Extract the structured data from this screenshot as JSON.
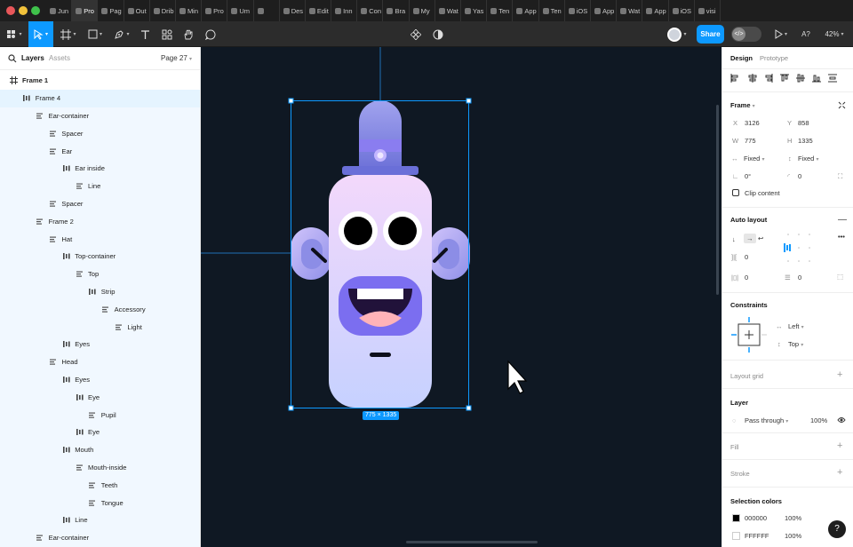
{
  "tabs": [
    "Jun",
    "Pro",
    "Pag",
    "Out",
    "Drib",
    "Min",
    "Pro",
    "Um",
    "",
    "Des",
    "Edit",
    "Inn",
    "Con",
    "Bra",
    "My",
    "Wat",
    "Yas",
    "Ten",
    "App",
    "Ten",
    "iOS",
    "App",
    "Wat",
    "App",
    "iOS",
    "visi"
  ],
  "toolbar": {
    "share_label": "Share",
    "zoom": "42%",
    "help": "A?"
  },
  "left": {
    "tab_layers": "Layers",
    "tab_assets": "Assets",
    "page": "Page 27",
    "layers": [
      {
        "label": "Frame 1",
        "depth": 0,
        "icon": "frame"
      },
      {
        "label": "Frame 4",
        "depth": 1,
        "icon": "vbars"
      },
      {
        "label": "Ear-container",
        "depth": 2,
        "icon": "lines"
      },
      {
        "label": "Spacer",
        "depth": 3,
        "icon": "lines"
      },
      {
        "label": "Ear",
        "depth": 3,
        "icon": "lines"
      },
      {
        "label": "Ear inside",
        "depth": 4,
        "icon": "vbars"
      },
      {
        "label": "Line",
        "depth": 5,
        "icon": "lines"
      },
      {
        "label": "Spacer",
        "depth": 3,
        "icon": "lines"
      },
      {
        "label": "Frame 2",
        "depth": 2,
        "icon": "lines"
      },
      {
        "label": "Hat",
        "depth": 3,
        "icon": "lines"
      },
      {
        "label": "Top-container",
        "depth": 4,
        "icon": "vbars"
      },
      {
        "label": "Top",
        "depth": 5,
        "icon": "lines"
      },
      {
        "label": "Strip",
        "depth": 6,
        "icon": "vbars"
      },
      {
        "label": "Accessory",
        "depth": 7,
        "icon": "lines"
      },
      {
        "label": "Light",
        "depth": 8,
        "icon": "lines"
      },
      {
        "label": "Eyes",
        "depth": 4,
        "icon": "vbars"
      },
      {
        "label": "Head",
        "depth": 3,
        "icon": "lines"
      },
      {
        "label": "Eyes",
        "depth": 4,
        "icon": "vbars"
      },
      {
        "label": "Eye",
        "depth": 5,
        "icon": "vbars"
      },
      {
        "label": "Pupil",
        "depth": 6,
        "icon": "lines"
      },
      {
        "label": "Eye",
        "depth": 5,
        "icon": "vbars"
      },
      {
        "label": "Mouth",
        "depth": 4,
        "icon": "vbars"
      },
      {
        "label": "Mouth-inside",
        "depth": 5,
        "icon": "lines"
      },
      {
        "label": "Teeth",
        "depth": 6,
        "icon": "lines"
      },
      {
        "label": "Tongue",
        "depth": 6,
        "icon": "lines"
      },
      {
        "label": "Line",
        "depth": 4,
        "icon": "vbars"
      },
      {
        "label": "Ear-container",
        "depth": 2,
        "icon": "lines"
      }
    ]
  },
  "canvas": {
    "size_label": "775 × 1335"
  },
  "right": {
    "tab_design": "Design",
    "tab_prototype": "Prototype",
    "frame_title": "Frame",
    "x_label": "X",
    "x": "3126",
    "y_label": "Y",
    "y": "858",
    "w_label": "W",
    "w": "775",
    "h_label": "H",
    "h": "1335",
    "hsizing": "Fixed",
    "vsizing": "Fixed",
    "rotation": "0°",
    "radius": "0",
    "clip": "Clip content",
    "autolayout_title": "Auto layout",
    "spacing": "0",
    "pad_h": "0",
    "pad_v": "0",
    "constraints_title": "Constraints",
    "c_h": "Left",
    "c_v": "Top",
    "layout_grid": "Layout grid",
    "layer_title": "Layer",
    "blend": "Pass through",
    "opacity": "100%",
    "fill": "Fill",
    "stroke": "Stroke",
    "selection_colors": "Selection colors",
    "colors": [
      {
        "hex": "000000",
        "opacity": "100%",
        "swatch": "#000000"
      },
      {
        "hex": "FFFFFF",
        "opacity": "100%",
        "swatch": "#FFFFFF"
      }
    ],
    "help": "?"
  },
  "colors": {
    "accent": "#0d99ff",
    "canvas_bg": "#0f1823",
    "character_top": "#f1d7fb",
    "character_bottom": "#c5d0ff",
    "hat": "#7f86e6"
  }
}
